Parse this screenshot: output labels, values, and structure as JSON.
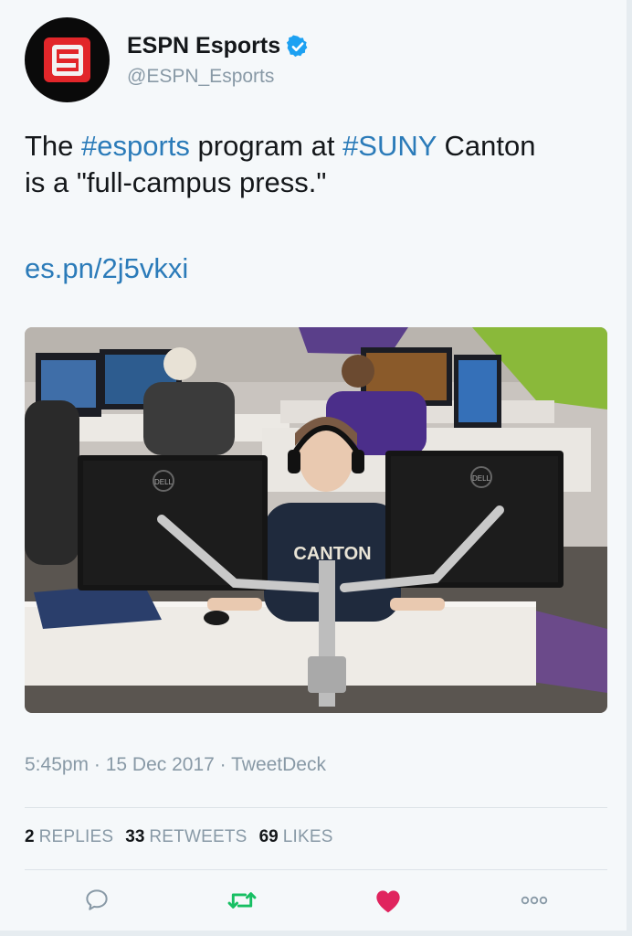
{
  "author": {
    "display_name": "ESPN Esports",
    "handle": "@ESPN_Esports"
  },
  "tweet": {
    "text_parts": [
      "The ",
      "#esports",
      " program at ",
      "#SUNY",
      " Canton",
      "is a \"full-campus press.\""
    ],
    "link": "es.pn/2j5vkxi"
  },
  "photo": {
    "jersey_text": "CANTON",
    "monitor_brand": "DELL"
  },
  "meta": {
    "time": "5:45pm",
    "separator": " · ",
    "date": "15 Dec 2017",
    "source": "TweetDeck"
  },
  "stats": {
    "replies_count": "2",
    "replies_label": "REPLIES",
    "retweets_count": "33",
    "retweets_label": "RETWEETS",
    "likes_count": "69",
    "likes_label": "LIKES"
  },
  "actions": {
    "reply_icon": "speech-bubble-icon",
    "retweet_icon": "retweet-arrows-icon",
    "like_icon": "heart-icon",
    "more_icon": "ellipsis-icon"
  },
  "colors": {
    "link_blue": "#2b7bb9",
    "verified_blue": "#1da1f2",
    "retweet_green": "#17bf63",
    "like_red": "#e0245e",
    "muted_gray": "#8899a6"
  }
}
